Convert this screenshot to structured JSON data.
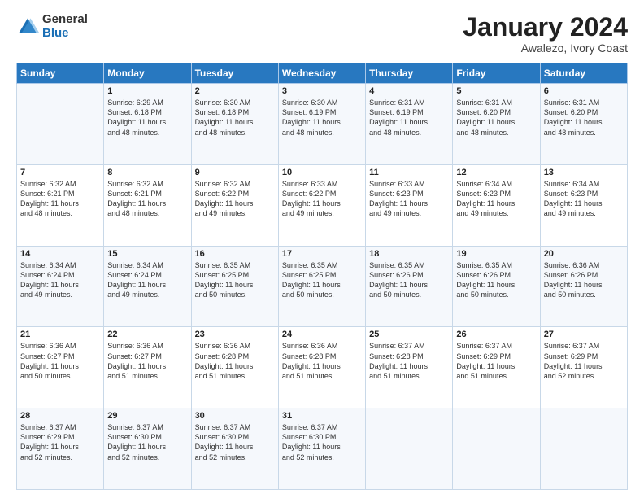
{
  "logo": {
    "general": "General",
    "blue": "Blue"
  },
  "header": {
    "month": "January 2024",
    "location": "Awalezo, Ivory Coast"
  },
  "weekdays": [
    "Sunday",
    "Monday",
    "Tuesday",
    "Wednesday",
    "Thursday",
    "Friday",
    "Saturday"
  ],
  "weeks": [
    [
      {
        "day": "",
        "info": ""
      },
      {
        "day": "1",
        "info": "Sunrise: 6:29 AM\nSunset: 6:18 PM\nDaylight: 11 hours\nand 48 minutes."
      },
      {
        "day": "2",
        "info": "Sunrise: 6:30 AM\nSunset: 6:18 PM\nDaylight: 11 hours\nand 48 minutes."
      },
      {
        "day": "3",
        "info": "Sunrise: 6:30 AM\nSunset: 6:19 PM\nDaylight: 11 hours\nand 48 minutes."
      },
      {
        "day": "4",
        "info": "Sunrise: 6:31 AM\nSunset: 6:19 PM\nDaylight: 11 hours\nand 48 minutes."
      },
      {
        "day": "5",
        "info": "Sunrise: 6:31 AM\nSunset: 6:20 PM\nDaylight: 11 hours\nand 48 minutes."
      },
      {
        "day": "6",
        "info": "Sunrise: 6:31 AM\nSunset: 6:20 PM\nDaylight: 11 hours\nand 48 minutes."
      }
    ],
    [
      {
        "day": "7",
        "info": "Sunrise: 6:32 AM\nSunset: 6:21 PM\nDaylight: 11 hours\nand 48 minutes."
      },
      {
        "day": "8",
        "info": "Sunrise: 6:32 AM\nSunset: 6:21 PM\nDaylight: 11 hours\nand 48 minutes."
      },
      {
        "day": "9",
        "info": "Sunrise: 6:32 AM\nSunset: 6:22 PM\nDaylight: 11 hours\nand 49 minutes."
      },
      {
        "day": "10",
        "info": "Sunrise: 6:33 AM\nSunset: 6:22 PM\nDaylight: 11 hours\nand 49 minutes."
      },
      {
        "day": "11",
        "info": "Sunrise: 6:33 AM\nSunset: 6:23 PM\nDaylight: 11 hours\nand 49 minutes."
      },
      {
        "day": "12",
        "info": "Sunrise: 6:34 AM\nSunset: 6:23 PM\nDaylight: 11 hours\nand 49 minutes."
      },
      {
        "day": "13",
        "info": "Sunrise: 6:34 AM\nSunset: 6:23 PM\nDaylight: 11 hours\nand 49 minutes."
      }
    ],
    [
      {
        "day": "14",
        "info": "Sunrise: 6:34 AM\nSunset: 6:24 PM\nDaylight: 11 hours\nand 49 minutes."
      },
      {
        "day": "15",
        "info": "Sunrise: 6:34 AM\nSunset: 6:24 PM\nDaylight: 11 hours\nand 49 minutes."
      },
      {
        "day": "16",
        "info": "Sunrise: 6:35 AM\nSunset: 6:25 PM\nDaylight: 11 hours\nand 50 minutes."
      },
      {
        "day": "17",
        "info": "Sunrise: 6:35 AM\nSunset: 6:25 PM\nDaylight: 11 hours\nand 50 minutes."
      },
      {
        "day": "18",
        "info": "Sunrise: 6:35 AM\nSunset: 6:26 PM\nDaylight: 11 hours\nand 50 minutes."
      },
      {
        "day": "19",
        "info": "Sunrise: 6:35 AM\nSunset: 6:26 PM\nDaylight: 11 hours\nand 50 minutes."
      },
      {
        "day": "20",
        "info": "Sunrise: 6:36 AM\nSunset: 6:26 PM\nDaylight: 11 hours\nand 50 minutes."
      }
    ],
    [
      {
        "day": "21",
        "info": "Sunrise: 6:36 AM\nSunset: 6:27 PM\nDaylight: 11 hours\nand 50 minutes."
      },
      {
        "day": "22",
        "info": "Sunrise: 6:36 AM\nSunset: 6:27 PM\nDaylight: 11 hours\nand 51 minutes."
      },
      {
        "day": "23",
        "info": "Sunrise: 6:36 AM\nSunset: 6:28 PM\nDaylight: 11 hours\nand 51 minutes."
      },
      {
        "day": "24",
        "info": "Sunrise: 6:36 AM\nSunset: 6:28 PM\nDaylight: 11 hours\nand 51 minutes."
      },
      {
        "day": "25",
        "info": "Sunrise: 6:37 AM\nSunset: 6:28 PM\nDaylight: 11 hours\nand 51 minutes."
      },
      {
        "day": "26",
        "info": "Sunrise: 6:37 AM\nSunset: 6:29 PM\nDaylight: 11 hours\nand 51 minutes."
      },
      {
        "day": "27",
        "info": "Sunrise: 6:37 AM\nSunset: 6:29 PM\nDaylight: 11 hours\nand 52 minutes."
      }
    ],
    [
      {
        "day": "28",
        "info": "Sunrise: 6:37 AM\nSunset: 6:29 PM\nDaylight: 11 hours\nand 52 minutes."
      },
      {
        "day": "29",
        "info": "Sunrise: 6:37 AM\nSunset: 6:30 PM\nDaylight: 11 hours\nand 52 minutes."
      },
      {
        "day": "30",
        "info": "Sunrise: 6:37 AM\nSunset: 6:30 PM\nDaylight: 11 hours\nand 52 minutes."
      },
      {
        "day": "31",
        "info": "Sunrise: 6:37 AM\nSunset: 6:30 PM\nDaylight: 11 hours\nand 52 minutes."
      },
      {
        "day": "",
        "info": ""
      },
      {
        "day": "",
        "info": ""
      },
      {
        "day": "",
        "info": ""
      }
    ]
  ]
}
